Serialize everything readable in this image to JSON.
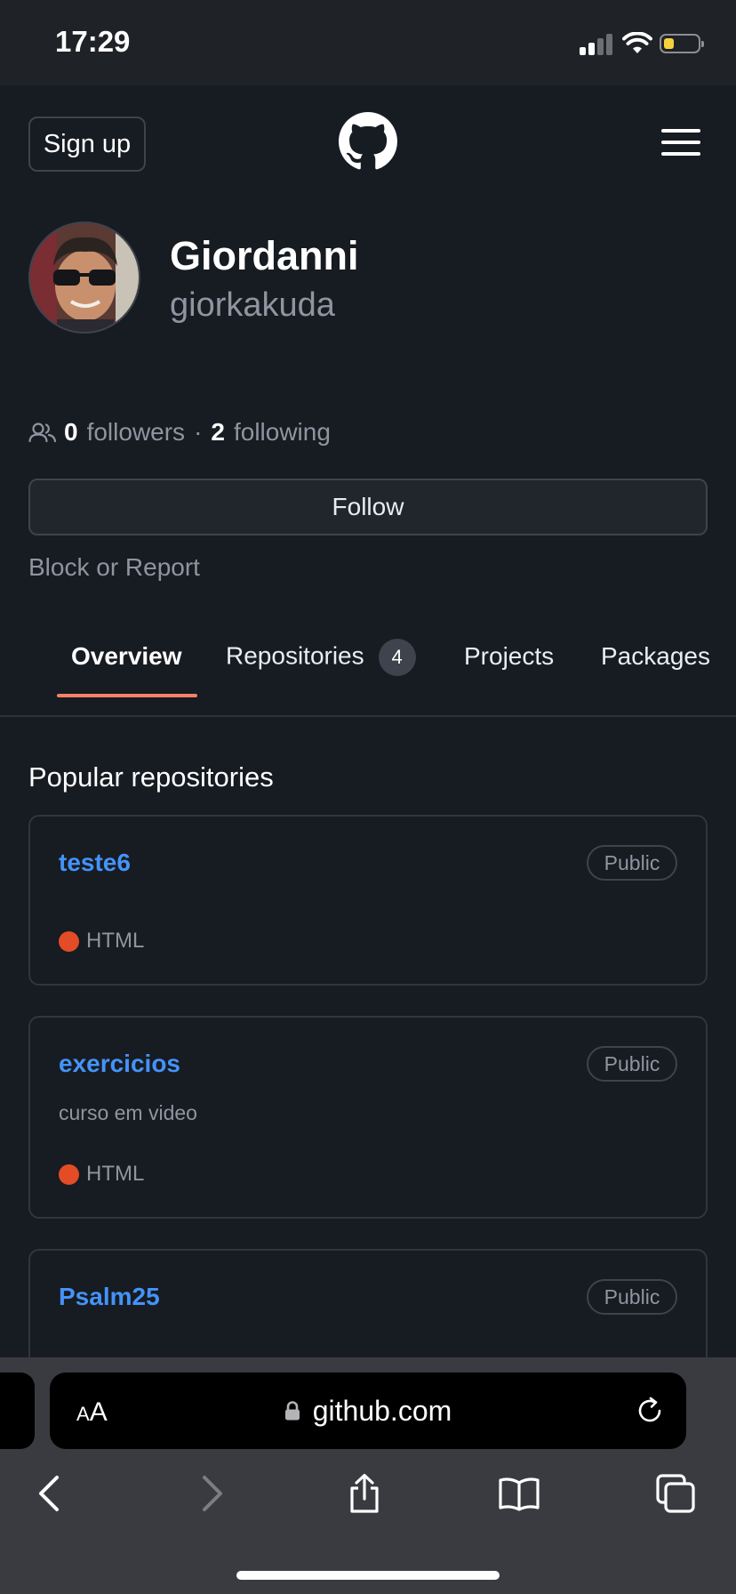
{
  "status_bar": {
    "time": "17:29"
  },
  "header": {
    "signup_label": "Sign up"
  },
  "profile": {
    "display_name": "Giordanni",
    "username": "giorkakuda",
    "followers_count": "0",
    "followers_label": "followers",
    "separator": "·",
    "following_count": "2",
    "following_label": "following",
    "follow_button": "Follow",
    "block_report": "Block or Report"
  },
  "tabs": [
    {
      "label": "Overview",
      "active": true
    },
    {
      "label": "Repositories",
      "count": "4"
    },
    {
      "label": "Projects"
    },
    {
      "label": "Packages"
    }
  ],
  "popular": {
    "title": "Popular repositories",
    "repos": [
      {
        "name": "teste6",
        "visibility": "Public",
        "description": "",
        "language": "HTML"
      },
      {
        "name": "exercicios",
        "visibility": "Public",
        "description": "curso em video",
        "language": "HTML"
      },
      {
        "name": "Psalm25",
        "visibility": "Public",
        "description": "",
        "language": ""
      }
    ]
  },
  "browser": {
    "aa_small": "A",
    "aa_large": "A",
    "url": "github.com"
  },
  "colors": {
    "background": "#171b22",
    "link": "#4493f8",
    "tab_underline": "#f78166",
    "html_language": "#e34c26"
  }
}
